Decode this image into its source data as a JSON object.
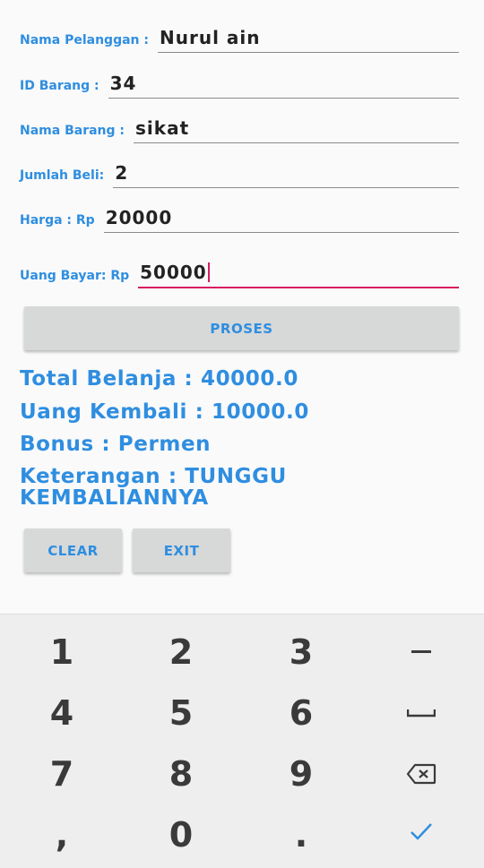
{
  "form": {
    "nama_pelanggan": {
      "label": "Nama Pelanggan :",
      "value": "Nurul ain"
    },
    "id_barang": {
      "label": "ID Barang :",
      "value": "34"
    },
    "nama_barang": {
      "label": "Nama Barang :",
      "value": "sikat"
    },
    "jumlah_beli": {
      "label": "Jumlah Beli:",
      "value": "2"
    },
    "harga": {
      "label": "Harga : Rp",
      "value": "20000"
    },
    "uang_bayar": {
      "label": "Uang Bayar: Rp",
      "value": "50000"
    }
  },
  "buttons": {
    "proses": "PROSES",
    "clear": "CLEAR",
    "exit": "EXIT"
  },
  "results": {
    "total_belanja": "Total Belanja : 40000.0",
    "uang_kembali": "Uang Kembali : 10000.0",
    "bonus": "Bonus : Permen",
    "keterangan_line1": "Keterangan : TUNGGU",
    "keterangan_line2": "KEMBALIANNYA"
  },
  "keyboard": {
    "keys": [
      "1",
      "2",
      "3",
      "4",
      "5",
      "6",
      "7",
      "8",
      "9",
      ",",
      "0",
      "."
    ],
    "special_icons": [
      "minus-icon",
      "space-icon",
      "backspace-icon",
      "done-check-icon"
    ],
    "accent_color": "#2f8ee0"
  },
  "colors": {
    "accent": "#2f8ee0",
    "focus_underline": "#d81b60",
    "button_bg": "#d7d8d8"
  }
}
